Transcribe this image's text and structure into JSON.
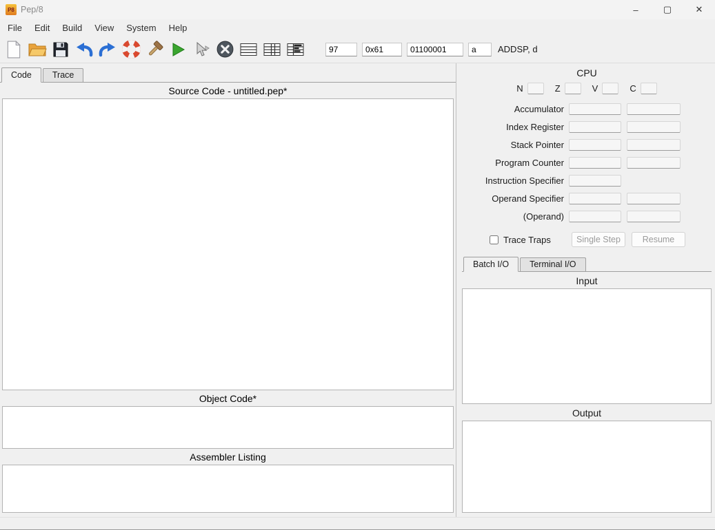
{
  "window": {
    "title": "Pep/8",
    "icon_text": "P8",
    "controls": {
      "minimize": "–",
      "maximize": "▢",
      "close": "✕"
    }
  },
  "menu": {
    "items": [
      "File",
      "Edit",
      "Build",
      "View",
      "System",
      "Help"
    ]
  },
  "toolbar": {
    "icons": [
      "new-file",
      "open-folder",
      "save-floppy",
      "undo-arrow",
      "redo-arrow",
      "lifebuoy",
      "build-hammer",
      "run-play",
      "debug-pointer",
      "stop-x",
      "view-code-table",
      "view-code-cpu-table",
      "view-code-cpu-memory-table"
    ],
    "converter": {
      "decimal": "97",
      "hex": "0x61",
      "binary": "01100001",
      "ascii": "a",
      "mnemonic": "ADDSP, d"
    }
  },
  "editor": {
    "tabs": [
      "Code",
      "Trace"
    ],
    "source_header": "Source Code - untitled.pep*",
    "object_header": "Object Code*",
    "listing_header": "Assembler Listing"
  },
  "cpu": {
    "title": "CPU",
    "flags": [
      "N",
      "Z",
      "V",
      "C"
    ],
    "registers": [
      "Accumulator",
      "Index Register",
      "Stack Pointer",
      "Program Counter",
      "Instruction Specifier",
      "Operand Specifier",
      "(Operand)"
    ],
    "trace_traps_label": "Trace Traps",
    "single_step_label": "Single Step",
    "resume_label": "Resume"
  },
  "io": {
    "tabs": [
      "Batch I/O",
      "Terminal I/O"
    ],
    "input_header": "Input",
    "output_header": "Output"
  }
}
